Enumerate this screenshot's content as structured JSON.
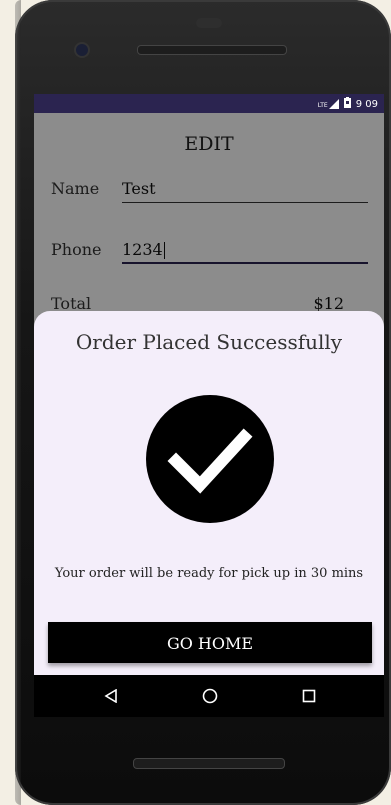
{
  "status_bar": {
    "network": "LTE",
    "time": "9 09"
  },
  "form": {
    "title": "EDIT",
    "name_label": "Name",
    "name_value": "Test",
    "phone_label": "Phone",
    "phone_value": "1234",
    "total_label": "Total",
    "total_value": "$12"
  },
  "dialog": {
    "title": "Order Placed Successfully",
    "icon": "check-circle-icon",
    "message": "Your order will be ready for pick up in 30 mins",
    "button_label": "GO HOME"
  },
  "nav": {
    "back_icon": "back-icon",
    "home_icon": "home-icon",
    "recents_icon": "recents-icon"
  },
  "colors": {
    "status_bar": "#2b2450",
    "sheet": "#f4eefa",
    "button": "#000000"
  }
}
